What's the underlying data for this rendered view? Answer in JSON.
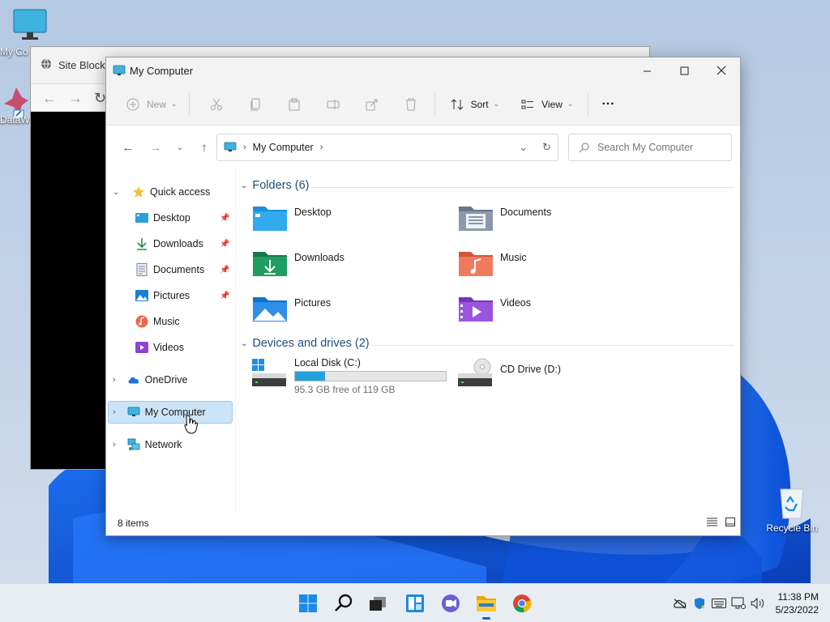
{
  "desktop": {
    "icons": [
      {
        "name": "my-computer",
        "label": "My Co"
      },
      {
        "name": "datawrapper",
        "label": "DataW"
      }
    ],
    "recycle_bin": {
      "label": "Recycle Bin"
    }
  },
  "background_window": {
    "tab_title": "Site Block"
  },
  "explorer": {
    "title": "My Computer",
    "toolbar": {
      "new_label": "New",
      "sort_label": "Sort",
      "view_label": "View",
      "more_label": "···"
    },
    "address": {
      "crumb": "My Computer"
    },
    "search": {
      "placeholder": "Search My Computer"
    },
    "nav": {
      "quick_access": "Quick access",
      "quick_items": [
        {
          "label": "Desktop",
          "pinned": true
        },
        {
          "label": "Downloads",
          "pinned": true
        },
        {
          "label": "Documents",
          "pinned": true
        },
        {
          "label": "Pictures",
          "pinned": true
        },
        {
          "label": "Music",
          "pinned": false
        },
        {
          "label": "Videos",
          "pinned": false
        }
      ],
      "onedrive": "OneDrive",
      "my_computer": "My Computer",
      "network": "Network"
    },
    "folders_group": {
      "header": "Folders (6)",
      "items": [
        {
          "label": "Desktop"
        },
        {
          "label": "Documents"
        },
        {
          "label": "Downloads"
        },
        {
          "label": "Music"
        },
        {
          "label": "Pictures"
        },
        {
          "label": "Videos"
        }
      ]
    },
    "drives_group": {
      "header": "Devices and drives (2)",
      "local_disk": {
        "label": "Local Disk (C:)",
        "free_text": "95.3 GB free of 119 GB",
        "used_fraction": 0.2
      },
      "cd_drive": {
        "label": "CD Drive (D:)"
      }
    },
    "status": {
      "count": "8 items"
    }
  },
  "taskbar": {
    "apps": [
      "start-icon",
      "search-icon",
      "task-view-icon",
      "widgets-icon",
      "chat-icon",
      "file-explorer-icon",
      "chrome-icon"
    ],
    "clock": {
      "time": "11:38 PM",
      "date": "5/23/2022"
    }
  },
  "colors": {
    "accent": "#0067c0",
    "selection": "#cce4f7",
    "drive_fill": "#26a0da",
    "group_header": "#1f4e79"
  }
}
